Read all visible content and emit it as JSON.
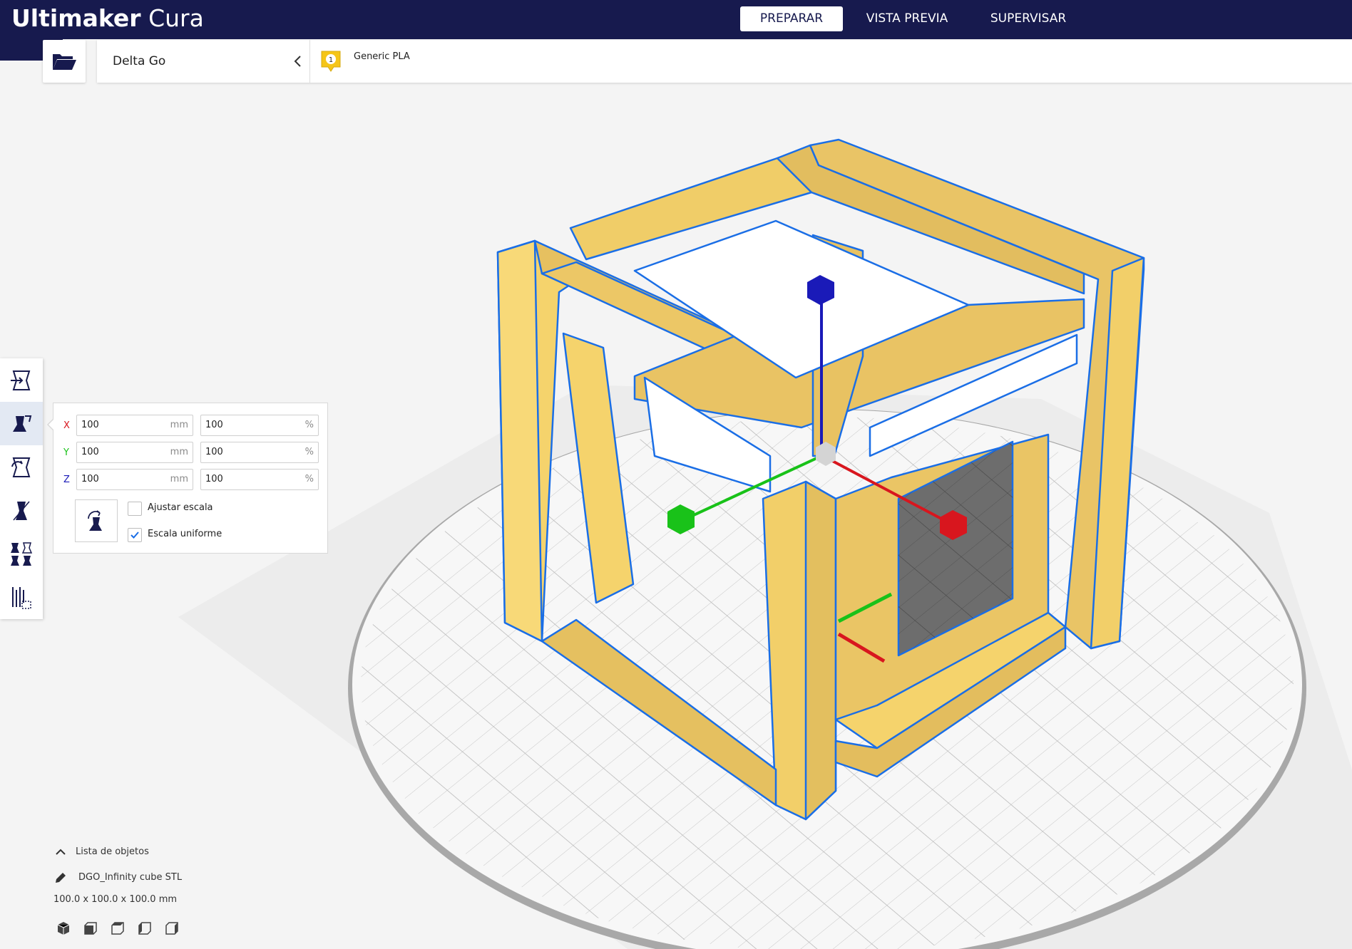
{
  "app": {
    "logo_bold": "Ultimaker",
    "logo_light": "Cura"
  },
  "stages": [
    {
      "label": "PREPARAR",
      "active": true
    },
    {
      "label": "VISTA PREVIA",
      "active": false
    },
    {
      "label": "SUPERVISAR",
      "active": false
    }
  ],
  "printer": {
    "name": "Delta Go"
  },
  "extruder": {
    "number": "1",
    "material": "Generic PLA",
    "color": "#f5c518"
  },
  "toolbar": {
    "tools": [
      {
        "name": "move-tool",
        "icon": "move-icon",
        "active": false
      },
      {
        "name": "scale-tool",
        "icon": "scale-icon",
        "active": true
      },
      {
        "name": "rotate-tool",
        "icon": "rotate-icon",
        "active": false
      },
      {
        "name": "mirror-tool",
        "icon": "mirror-icon",
        "active": false
      },
      {
        "name": "per-model-settings-tool",
        "icon": "per-model-settings-icon",
        "active": false
      },
      {
        "name": "support-blocker-tool",
        "icon": "support-blocker-icon",
        "active": false
      }
    ]
  },
  "scale_panel": {
    "x": {
      "label": "X",
      "mm": "100",
      "mm_unit": "mm",
      "pct": "100",
      "pct_unit": "%"
    },
    "y": {
      "label": "Y",
      "mm": "100",
      "mm_unit": "mm",
      "pct": "100",
      "pct_unit": "%"
    },
    "z": {
      "label": "Z",
      "mm": "100",
      "mm_unit": "mm",
      "pct": "100",
      "pct_unit": "%"
    },
    "snap_scaling": {
      "label": "Ajustar escala",
      "checked": false
    },
    "uniform_scaling": {
      "label": "Escala uniforme",
      "checked": true
    }
  },
  "object_list": {
    "header": "Lista de objetos",
    "object_name": "DGO_Infinity cube STL",
    "dimensions": "100.0 x 100.0 x 100.0 mm"
  },
  "view_buttons": [
    "3d-view-icon",
    "front-view-icon",
    "top-view-icon",
    "left-view-icon",
    "right-view-icon"
  ],
  "colors": {
    "header_bg": "#171a4e",
    "model_yellow": "#f5d36c",
    "model_outline": "#1a6ee6",
    "axis_x": "#d8161e",
    "axis_y": "#19c219",
    "axis_z": "#1a1ab8",
    "build_plate": "#f7f7f7"
  }
}
